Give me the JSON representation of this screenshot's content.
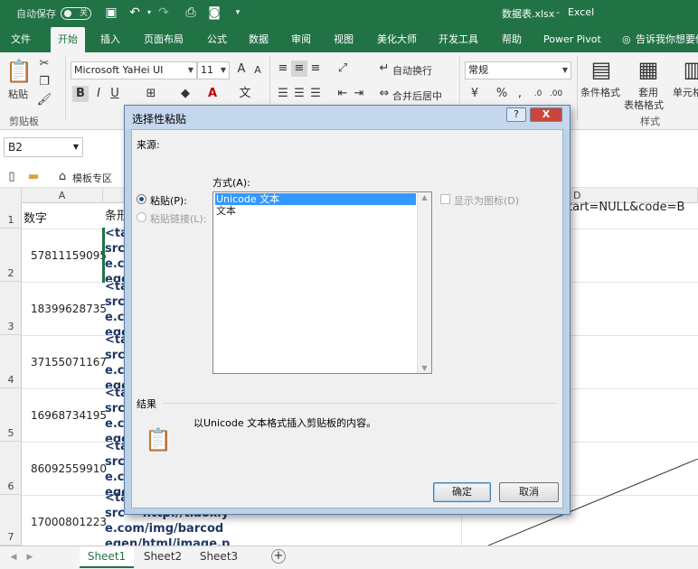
{
  "titlebar": {
    "autosave_label": "自动保存",
    "toggle_state": "关",
    "filename": "数据表.xlsx",
    "separator": "-",
    "app_name": "Excel"
  },
  "tabs": [
    "文件",
    "开始",
    "插入",
    "页面布局",
    "公式",
    "数据",
    "审阅",
    "视图",
    "美化大师",
    "开发工具",
    "帮助",
    "Power Pivot",
    "告诉我你想要做"
  ],
  "ribbon": {
    "paste_label": "粘贴",
    "clipboard_group": "剪贴板",
    "font_name": "Microsoft YaHei UI",
    "font_size": "11",
    "wrap_text": "自动换行",
    "merge_center": "合并后居中",
    "number_format": "常规",
    "conditional_format": "条件格式",
    "table_format_1": "套用",
    "table_format_2": "表格格式",
    "cell_style": "单元格",
    "style_group": "样式"
  },
  "formula_bar": {
    "name_box": "B2"
  },
  "favorites": {
    "templates": "模板专区"
  },
  "grid": {
    "columns": [
      "A",
      "D"
    ],
    "row_numbers": [
      "1",
      "2",
      "3",
      "4",
      "5",
      "6",
      "7"
    ],
    "header_a": "数字",
    "header_b": "条形",
    "header_d_fragment": "tart=NULL&code=B",
    "col_a_values": [
      "57811159095",
      "18399628735",
      "37155071167",
      "16968734195",
      "86092559910",
      "17000801223"
    ],
    "col_b_lines": [
      "<ta\nsrc\ne.co\nege",
      "<ta\nsrc\ne.co\nege",
      "<ta\nsrc\ne.co\nege",
      "<ta\nsrc\ne.co\nege",
      "<ta\nsrc\ne.co\nege",
      "<ta\nsrc=  http://tiaoxiyu\ne.com/img/barcod\negen/html/image.p"
    ]
  },
  "sheets": [
    "Sheet1",
    "Sheet2",
    "Sheet3"
  ],
  "dialog": {
    "title": "选择性粘贴",
    "help": "?",
    "close": "X",
    "source_label": "来源:",
    "method_label": "方式(A):",
    "paste_option": "粘贴(P):",
    "paste_link_option": "粘贴链接(L):",
    "formats": [
      "Unicode 文本",
      "文本"
    ],
    "show_as_icon": "显示为图标(D)",
    "result_label": "结果",
    "result_text": "以Unicode 文本格式插入剪贴板的内容。",
    "ok": "确定",
    "cancel": "取消"
  }
}
